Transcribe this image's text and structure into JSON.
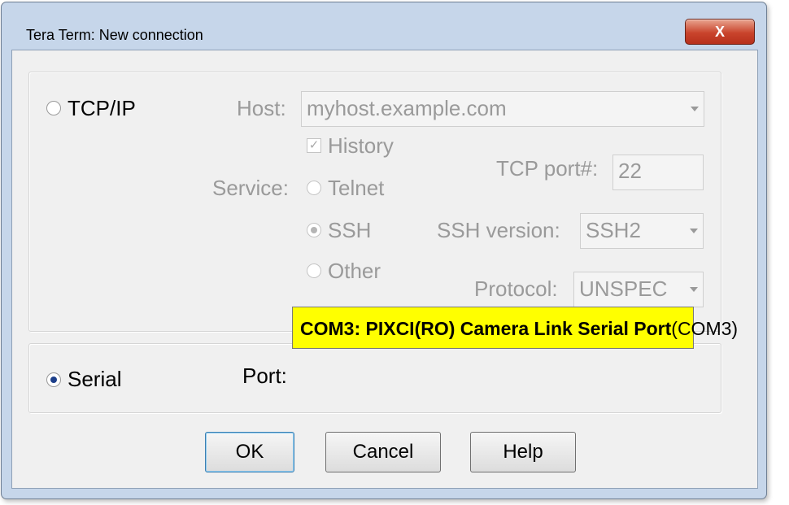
{
  "window": {
    "title": "Tera Term: New connection",
    "close_label": "X"
  },
  "tcpip": {
    "radio_label": "TCP/IP",
    "host_label": "Host:",
    "host_value": "myhost.example.com",
    "history_label": "History",
    "service_label": "Service:",
    "telnet_label": "Telnet",
    "ssh_label": "SSH",
    "other_label": "Other",
    "tcp_port_label": "TCP port#:",
    "tcp_port_value": "22",
    "ssh_version_label": "SSH version:",
    "ssh_version_value": "SSH2",
    "protocol_label": "Protocol:",
    "protocol_value": "UNSPEC"
  },
  "serial": {
    "radio_label": "Serial",
    "port_label": "Port:",
    "port_value": "COM3: PIXCI(RO) Camera Link Serial Port",
    "port_suffix": "(COM3)"
  },
  "buttons": {
    "ok": "OK",
    "cancel": "Cancel",
    "help": "Help"
  },
  "colors": {
    "highlight": "#ffff00",
    "close_button": "#c9442c"
  }
}
